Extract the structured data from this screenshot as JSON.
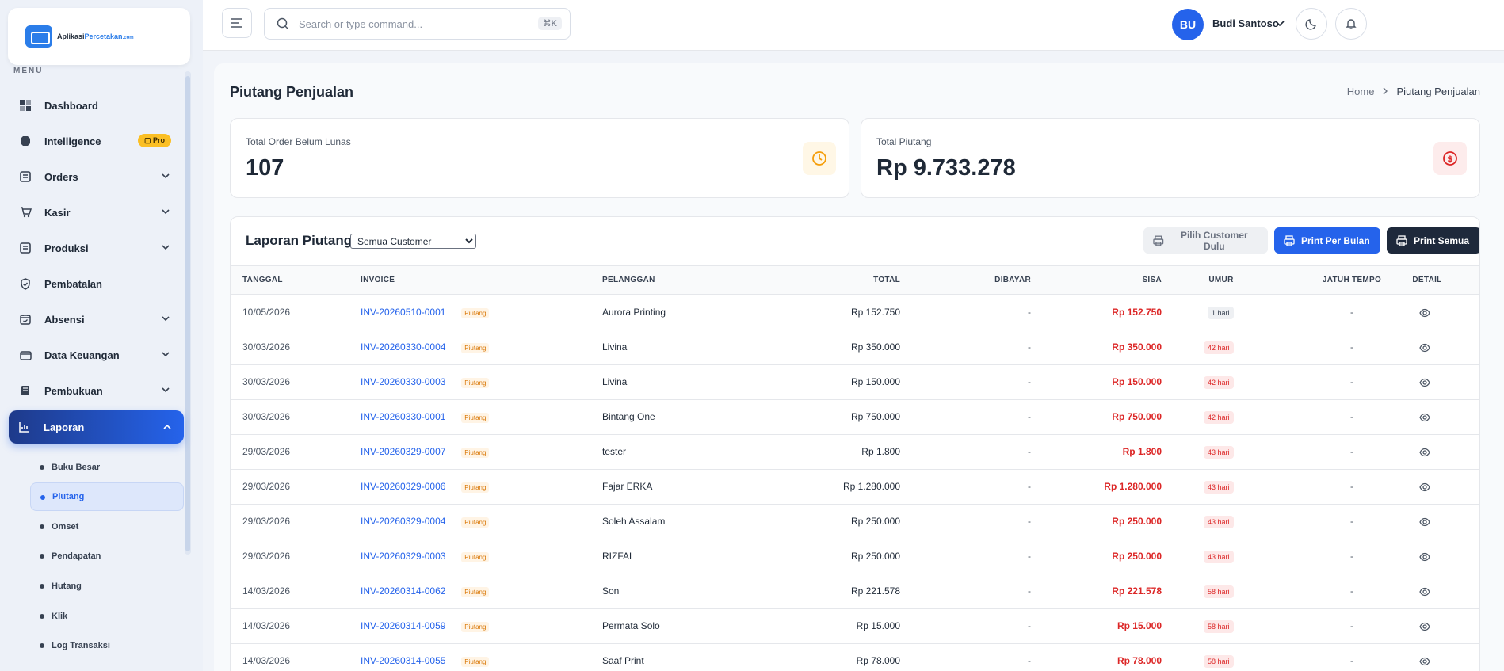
{
  "brand": {
    "name_part1": "Aplikasi",
    "name_part2": "Percetakan",
    "name_part3": ".com"
  },
  "sidebar": {
    "menu_label": "MENU",
    "items": [
      {
        "label": "Dashboard",
        "icon": "dashboard-icon"
      },
      {
        "label": "Intelligence",
        "icon": "brain-icon",
        "badge": "Pro"
      },
      {
        "label": "Orders",
        "icon": "orders-icon"
      },
      {
        "label": "Kasir",
        "icon": "cart-icon"
      },
      {
        "label": "Produksi",
        "icon": "production-icon"
      },
      {
        "label": "Pembatalan",
        "icon": "shield-icon"
      },
      {
        "label": "Absensi",
        "icon": "calendar-check-icon"
      },
      {
        "label": "Data Keuangan",
        "icon": "wallet-icon"
      },
      {
        "label": "Pembukuan",
        "icon": "book-icon"
      },
      {
        "label": "Laporan",
        "icon": "bar-chart-icon"
      }
    ],
    "sub_items": [
      {
        "label": "Buku Besar"
      },
      {
        "label": "Piutang"
      },
      {
        "label": "Omset"
      },
      {
        "label": "Pendapatan"
      },
      {
        "label": "Hutang"
      },
      {
        "label": "Klik"
      },
      {
        "label": "Log Transaksi"
      }
    ]
  },
  "topbar": {
    "search_placeholder": "Search or type command...",
    "shortcut": "⌘K",
    "user_initials": "BU",
    "user_name": "Budi Santoso"
  },
  "page": {
    "title": "Piutang Penjualan",
    "breadcrumb_home": "Home",
    "breadcrumb_current": "Piutang Penjualan"
  },
  "stats": {
    "orders_label": "Total Order Belum Lunas",
    "orders_value": "107",
    "piutang_label": "Total Piutang",
    "piutang_value": "Rp 9.733.278"
  },
  "report": {
    "title": "Laporan Piutang",
    "customer_filter": "Semua Customer",
    "btn_pilih": "Pilih Customer Dulu",
    "btn_print_bulan": "Print Per Bulan",
    "btn_print_semua": "Print Semua",
    "columns": [
      "TANGGAL",
      "INVOICE",
      "PELANGGAN",
      "TOTAL",
      "DIBAYAR",
      "SISA",
      "UMUR",
      "JATUH TEMPO",
      "DETAIL"
    ],
    "rows": [
      {
        "tanggal": "10/05/2026",
        "invoice": "INV-20260510-0001",
        "tag": "Piutang",
        "pelanggan": "Aurora Printing",
        "total": "Rp 152.750",
        "dibayar": "-",
        "sisa": "Rp 152.750",
        "umur": "1 hari",
        "tempo": "-"
      },
      {
        "tanggal": "30/03/2026",
        "invoice": "INV-20260330-0004",
        "tag": "Piutang",
        "pelanggan": "Livina",
        "total": "Rp 350.000",
        "dibayar": "-",
        "sisa": "Rp 350.000",
        "umur": "42 hari",
        "tempo": "-"
      },
      {
        "tanggal": "30/03/2026",
        "invoice": "INV-20260330-0003",
        "tag": "Piutang",
        "pelanggan": "Livina",
        "total": "Rp 150.000",
        "dibayar": "-",
        "sisa": "Rp 150.000",
        "umur": "42 hari",
        "tempo": "-"
      },
      {
        "tanggal": "30/03/2026",
        "invoice": "INV-20260330-0001",
        "tag": "Piutang",
        "pelanggan": "Bintang One",
        "total": "Rp 750.000",
        "dibayar": "-",
        "sisa": "Rp 750.000",
        "umur": "42 hari",
        "tempo": "-"
      },
      {
        "tanggal": "29/03/2026",
        "invoice": "INV-20260329-0007",
        "tag": "Piutang",
        "pelanggan": "tester",
        "total": "Rp 1.800",
        "dibayar": "-",
        "sisa": "Rp 1.800",
        "umur": "43 hari",
        "tempo": "-"
      },
      {
        "tanggal": "29/03/2026",
        "invoice": "INV-20260329-0006",
        "tag": "Piutang",
        "pelanggan": "Fajar ERKA",
        "total": "Rp 1.280.000",
        "dibayar": "-",
        "sisa": "Rp 1.280.000",
        "umur": "43 hari",
        "tempo": "-"
      },
      {
        "tanggal": "29/03/2026",
        "invoice": "INV-20260329-0004",
        "tag": "Piutang",
        "pelanggan": "Soleh Assalam",
        "total": "Rp 250.000",
        "dibayar": "-",
        "sisa": "Rp 250.000",
        "umur": "43 hari",
        "tempo": "-"
      },
      {
        "tanggal": "29/03/2026",
        "invoice": "INV-20260329-0003",
        "tag": "Piutang",
        "pelanggan": "RIZFAL",
        "total": "Rp 250.000",
        "dibayar": "-",
        "sisa": "Rp 250.000",
        "umur": "43 hari",
        "tempo": "-"
      },
      {
        "tanggal": "14/03/2026",
        "invoice": "INV-20260314-0062",
        "tag": "Piutang",
        "pelanggan": "Son",
        "total": "Rp 221.578",
        "dibayar": "-",
        "sisa": "Rp 221.578",
        "umur": "58 hari",
        "tempo": "-"
      },
      {
        "tanggal": "14/03/2026",
        "invoice": "INV-20260314-0059",
        "tag": "Piutang",
        "pelanggan": "Permata Solo",
        "total": "Rp 15.000",
        "dibayar": "-",
        "sisa": "Rp 15.000",
        "umur": "58 hari",
        "tempo": "-"
      },
      {
        "tanggal": "14/03/2026",
        "invoice": "INV-20260314-0055",
        "tag": "Piutang",
        "pelanggan": "Saaf Print",
        "total": "Rp 78.000",
        "dibayar": "-",
        "sisa": "Rp 78.000",
        "umur": "58 hari",
        "tempo": "-"
      }
    ]
  },
  "colors": {
    "accent": "#2563eb",
    "danger": "#dc2626",
    "warning": "#f59e0b",
    "dark": "#1e293b"
  }
}
